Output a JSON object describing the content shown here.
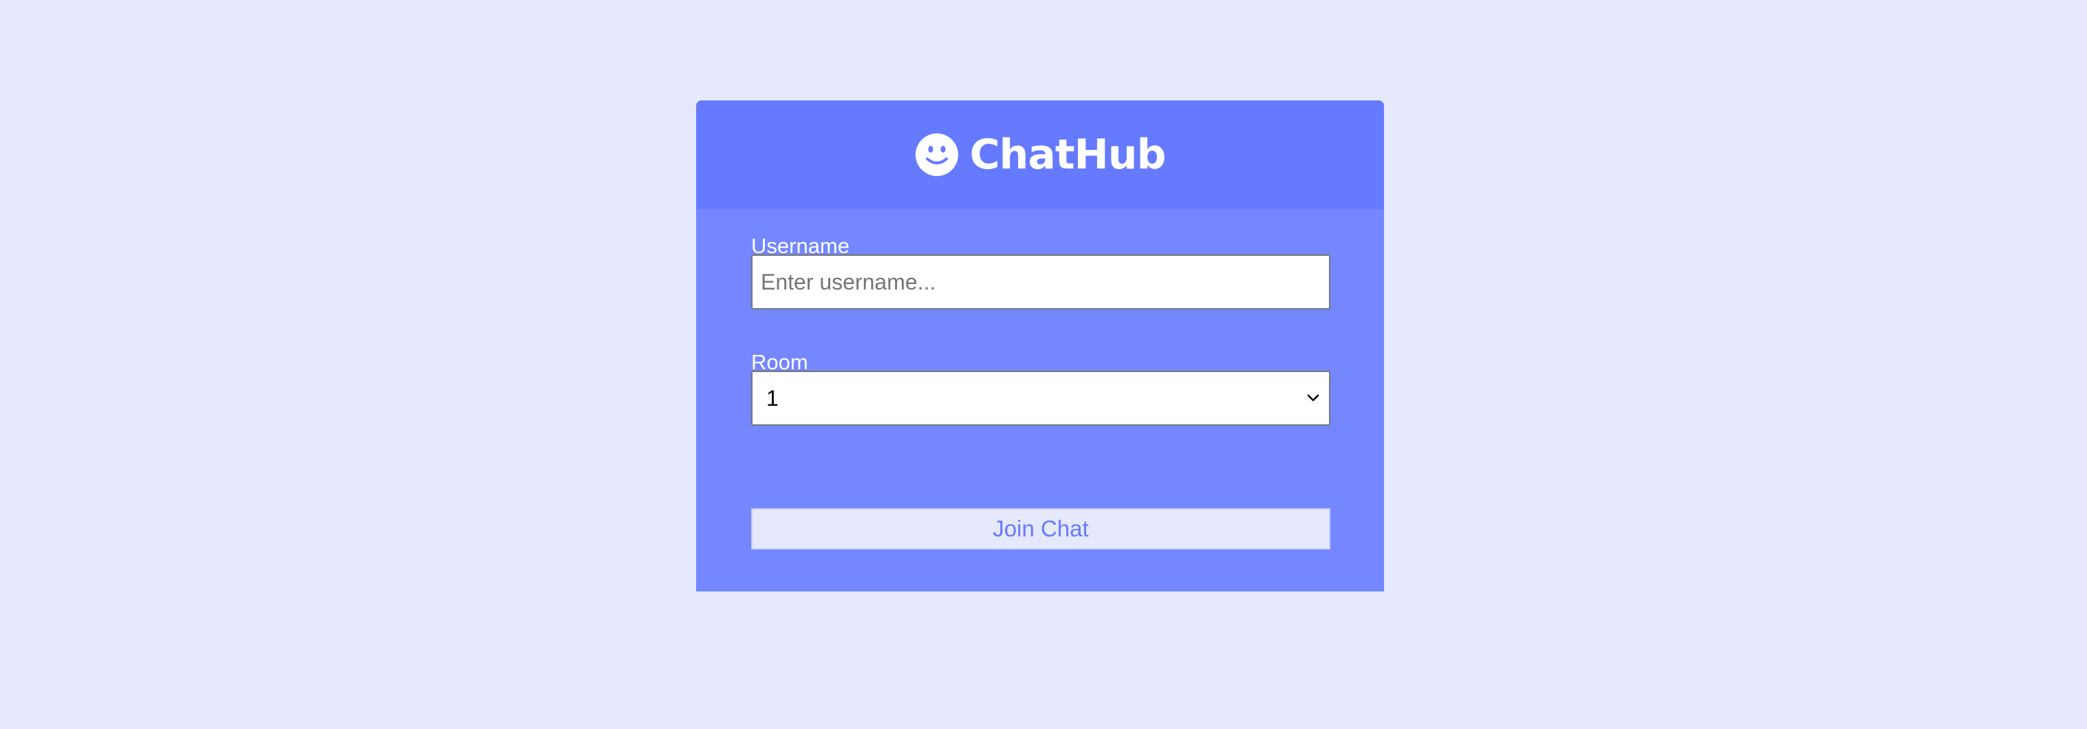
{
  "app": {
    "title": "ChatHub",
    "logo_icon": "smiley-icon"
  },
  "form": {
    "username_label": "Username",
    "username_placeholder": "Enter username...",
    "username_value": "",
    "room_label": "Room",
    "room_selected": "1",
    "join_button_label": "Join Chat"
  },
  "colors": {
    "page_background": "#e6e8fe",
    "card_background": "#7487ff",
    "header_background": "#667aff",
    "button_text": "#667aff"
  }
}
